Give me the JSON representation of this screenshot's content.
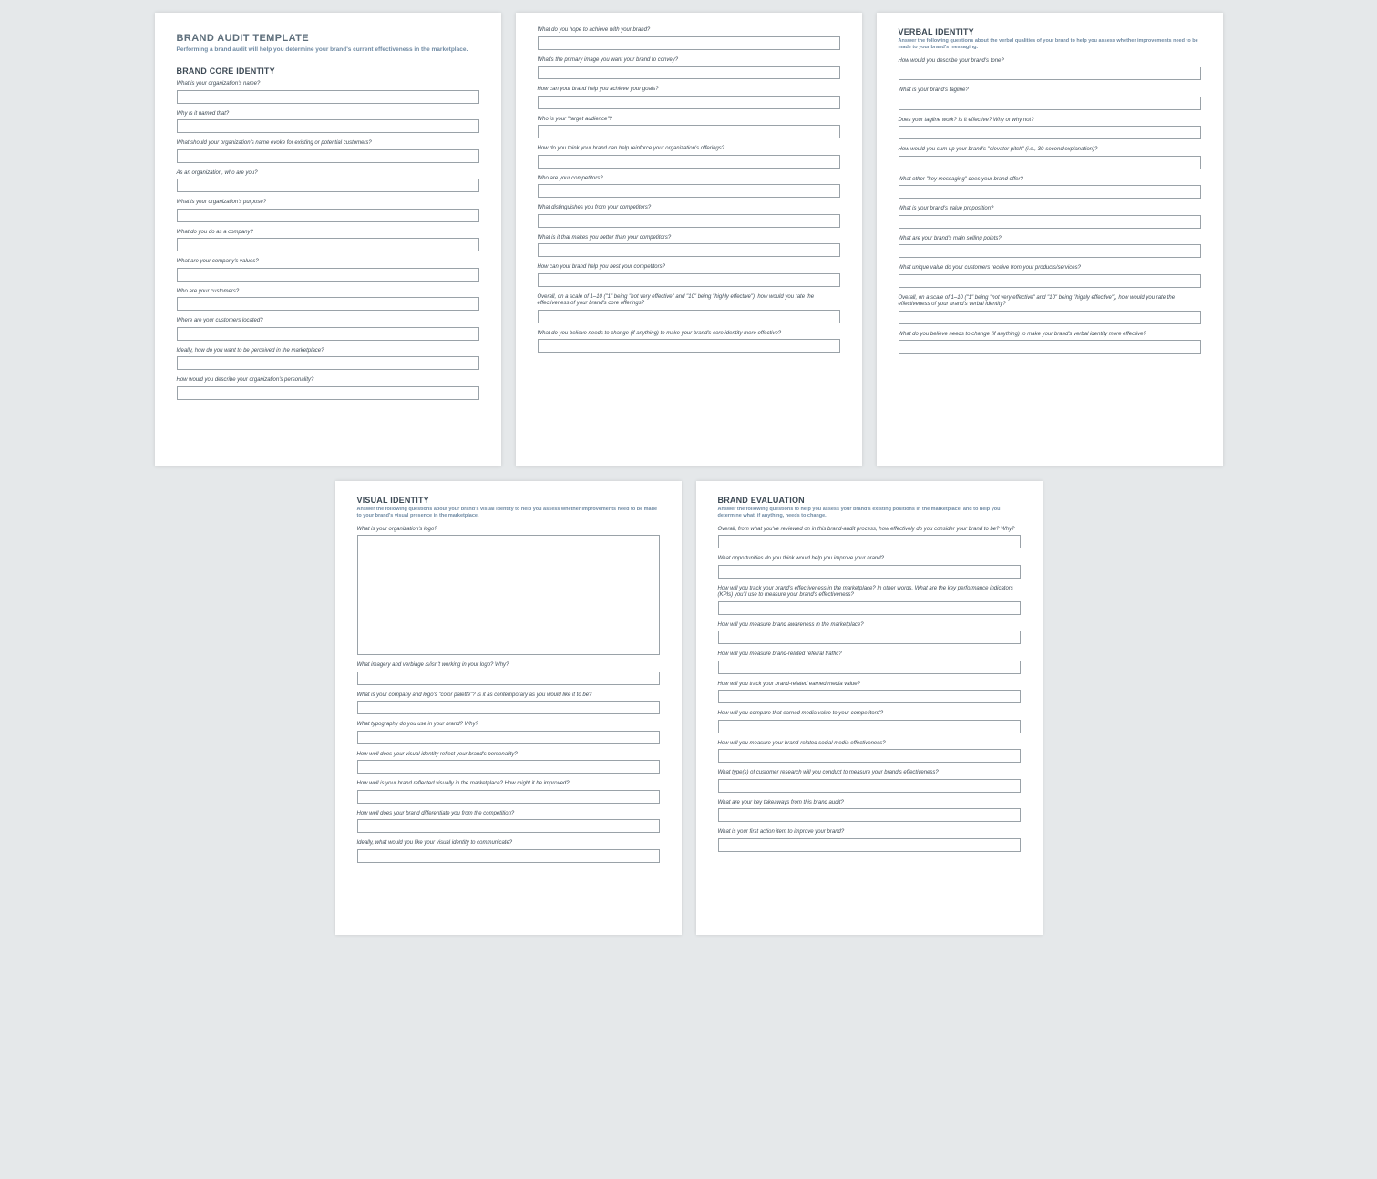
{
  "doc": {
    "title": "BRAND AUDIT TEMPLATE",
    "subtitle": "Performing a brand audit will help you determine your brand's current effectiveness in the marketplace."
  },
  "core": {
    "title": "BRAND CORE IDENTITY",
    "q1": "What is your organization's name?",
    "q2": "Why is it named that?",
    "q3": "What should your organization's name evoke for existing or potential customers?",
    "q4": "As an organization, who are you?",
    "q5": "What is your organization's purpose?",
    "q6": "What do you do as a company?",
    "q7": "What are your company's values?",
    "q8": "Who are your customers?",
    "q9": "Where are your customers located?",
    "q10": "Ideally, how do you want to be perceived in the marketplace?",
    "q11": "How would you describe your organization's personality?"
  },
  "core2": {
    "q1": "What do you hope to achieve with your brand?",
    "q2": "What's the primary image you want your brand to convey?",
    "q3": "How can your brand help you achieve your goals?",
    "q4": "Who is your \"target audience\"?",
    "q5": "How do you think your brand can help reinforce your organization's offerings?",
    "q6": "Who are your competitors?",
    "q7": "What distinguishes you from your competitors?",
    "q8": "What is it that makes you better than your competitors?",
    "q9": "How can your brand help you best your competitors?",
    "q10": "Overall, on a scale of 1–10 (\"1\" being \"not very effective\" and \"10\" being \"highly effective\"), how would you rate the effectiveness of your brand's core offerings?",
    "q11": "What do you believe needs to change (if anything) to make your brand's core identity more effective?"
  },
  "verbal": {
    "title": "VERBAL IDENTITY",
    "sub": "Answer the following questions about the verbal qualities of your brand to help you assess whether improvements need to be made to your brand's messaging.",
    "q1": "How would you describe your brand's tone?",
    "q2": "What is your brand's tagline?",
    "q3": "Does your tagline work? Is it effective? Why or why not?",
    "q4": "How would you sum up your brand's \"elevator pitch\" (i.e., 30-second explanation)?",
    "q5": "What other \"key messaging\" does your brand offer?",
    "q6": "What is your brand's value proposition?",
    "q7": "What are your brand's main selling points?",
    "q8": "What unique value do your customers receive from your products/services?",
    "q9": "Overall, on a scale of 1–10 (\"1\" being \"not very effective\" and \"10\" being \"highly effective\"), how would you rate the effectiveness of your brand's verbal identity?",
    "q10": "What do you believe needs to change (if anything) to make your brand's verbal identity more effective?"
  },
  "visual": {
    "title": "VISUAL IDENTITY",
    "sub": "Answer the following questions about your brand's visual identity to help you assess whether improvements need to be made to your brand's visual presence in the marketplace.",
    "q1": "What is your organization's logo?",
    "q2": "What imagery and verbiage is/isn't working in your logo? Why?",
    "q3": "What is your company and logo's \"color palette\"? Is it as contemporary as you would like it to be?",
    "q4": "What typography do you use in your brand? Why?",
    "q5": "How well does your visual identity reflect your brand's personality?",
    "q6": "How well is your brand reflected visually in the marketplace? How might it be improved?",
    "q7": "How well does your brand differentiate you from the competition?",
    "q8": "Ideally, what would you like your visual identity to communicate?"
  },
  "eval": {
    "title": "BRAND EVALUATION",
    "sub": "Answer the following questions to help you assess your brand's existing positions in the marketplace, and to help you determine what, if anything, needs to change.",
    "q1": "Overall, from what you've reviewed on in this brand-audit process, how effectively do you consider your brand to be? Why?",
    "q2": "What opportunities do you think would help you improve your brand?",
    "q3": "How will you track your brand's effectiveness in the marketplace? In other words, What are the key performance indicators (KPIs) you'll use to measure your brand's effectiveness?",
    "q4": "How will you measure brand awareness in the marketplace?",
    "q5": "How will you measure brand-related referral traffic?",
    "q6": "How will you track your brand-related earned media value?",
    "q7": "How will you compare that earned media value to your competitors'?",
    "q8": "How will you measure your brand-related social media effectiveness?",
    "q9": "What type(s) of customer research will you conduct to measure your brand's effectiveness?",
    "q10": "What are your key takeaways from this brand audit?",
    "q11": "What is your first action item to improve your brand?"
  }
}
